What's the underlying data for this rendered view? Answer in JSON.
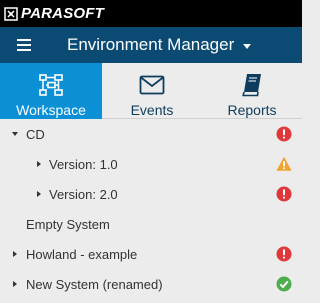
{
  "brand": {
    "name": "PARASOFT"
  },
  "header": {
    "title": "Environment Manager",
    "menu_icon": "hamburger-menu-icon",
    "dropdown_icon": "caret-down-icon"
  },
  "tabs": [
    {
      "label": "Workspace",
      "icon": "workspace-tree-icon",
      "active": true
    },
    {
      "label": "Events",
      "icon": "envelope-icon",
      "active": false
    },
    {
      "label": "Reports",
      "icon": "book-icon",
      "active": false
    }
  ],
  "tree": {
    "items": [
      {
        "label": "CD",
        "expanded": true,
        "status": "error"
      },
      {
        "label": "Version: 1.0",
        "expanded": false,
        "status": "warning"
      },
      {
        "label": "Version: 2.0",
        "expanded": false,
        "status": "error"
      },
      {
        "label": "Empty System",
        "expanded": null,
        "status": "none"
      },
      {
        "label": "Howland - example",
        "expanded": false,
        "status": "error"
      },
      {
        "label": "New System (renamed)",
        "expanded": false,
        "status": "ok"
      }
    ]
  },
  "colors": {
    "brand_bar": "#000000",
    "header": "#0b4a73",
    "active_tab": "#0b90d6",
    "background": "#ececec",
    "error": "#e0383a",
    "warning": "#f0a431",
    "ok": "#4cae4c"
  }
}
